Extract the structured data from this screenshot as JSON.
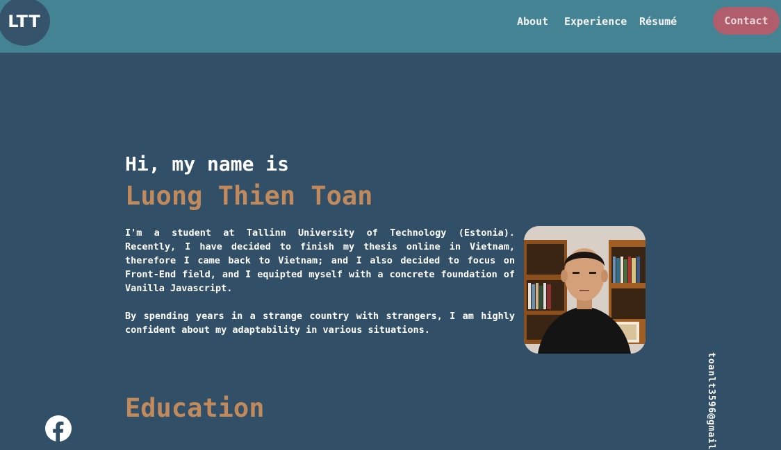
{
  "header": {
    "logo": "LTT",
    "nav": [
      "About",
      "Experience",
      "Résumé"
    ],
    "contact_label": "Contact"
  },
  "hero": {
    "greeting": "Hi, my name is",
    "name": "Luong Thien Toan",
    "bio": [
      "I'm a student at Tallinn University of Technology (Estonia). Recently, I have decided to finish my thesis online in Vietnam, therefore I came back to Vietnam; and I also decided to focus on Front-End field, and I equipted myself with a concrete foundation of Vanilla Javascript.",
      "By spending years in a strange country with strangers, I am highly confident about my adaptability in various situations."
    ]
  },
  "sidebar": {
    "email": "toanlt3596@gmail",
    "social_icon": "facebook-icon"
  },
  "education": {
    "heading": "Education"
  },
  "colors": {
    "header_bg": "#448393",
    "page_bg": "#324f68",
    "accent": "#c08a5c",
    "contact_bg": "#b15e6c"
  }
}
